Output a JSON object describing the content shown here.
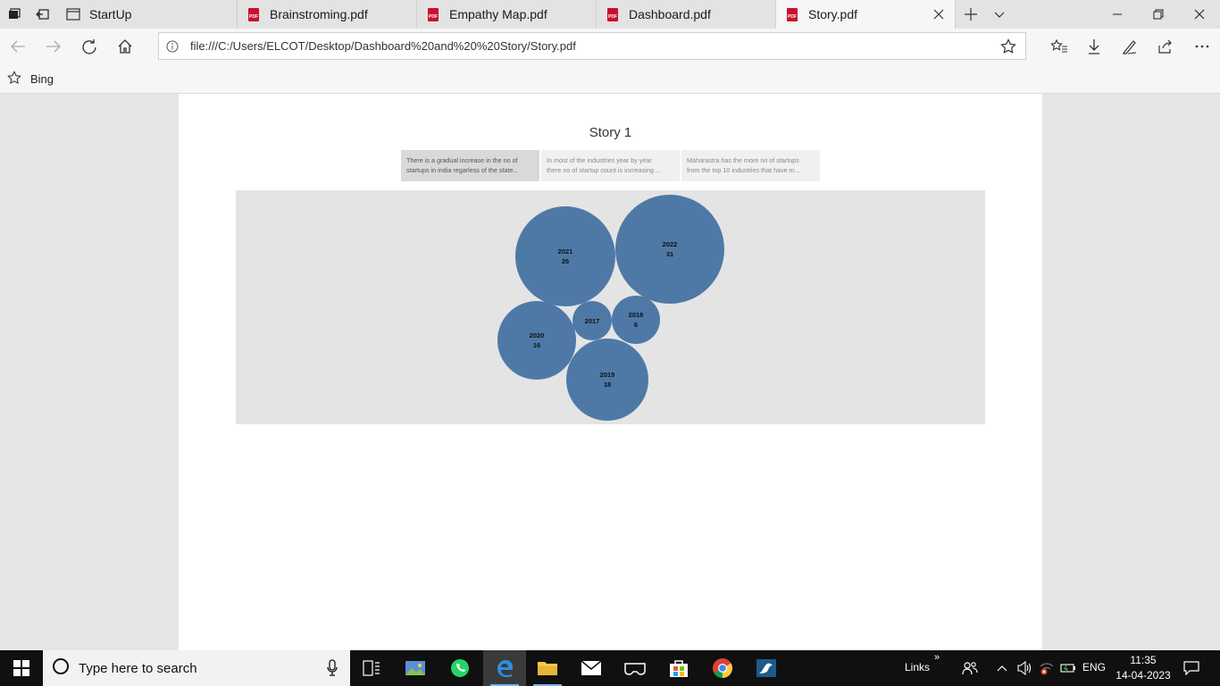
{
  "tabs": [
    {
      "label": "StartUp",
      "icon": "page-icon"
    },
    {
      "label": "Brainstroming.pdf",
      "icon": "pdf-icon"
    },
    {
      "label": "Empathy Map.pdf",
      "icon": "pdf-icon"
    },
    {
      "label": "Dashboard.pdf",
      "icon": "pdf-icon"
    },
    {
      "label": "Story.pdf",
      "icon": "pdf-icon",
      "active": true
    }
  ],
  "pdf_icon_text": "PDF",
  "address": {
    "url": "file:///C:/Users/ELCOT/Desktop/Dashboard%20and%20%20Story/Story.pdf"
  },
  "favorites": [
    {
      "label": "Bing"
    }
  ],
  "story": {
    "title": "Story 1",
    "points": [
      {
        "line1": "There is a gradual increase in the no of",
        "line2": "startups in india regarless of the state..."
      },
      {
        "line1": "In most of the industries year by year",
        "line2": "there no of startup count is increasing ..."
      },
      {
        "line1": "Maharastra has the more no of startups",
        "line2": "from the top 10 industries that have m..."
      }
    ]
  },
  "chart_data": {
    "type": "packed-bubble",
    "color": "#4e79a7",
    "categories": [
      "2022",
      "2021",
      "2019",
      "2020",
      "2018",
      "2017"
    ],
    "values": [
      31,
      26,
      18,
      16,
      6,
      null
    ],
    "labels": [
      {
        "year": "2022",
        "value": "31"
      },
      {
        "year": "2021",
        "value": "26"
      },
      {
        "year": "2019",
        "value": "18"
      },
      {
        "year": "2020",
        "value": "16"
      },
      {
        "year": "2018",
        "value": "6"
      },
      {
        "year": "2017",
        "value": ""
      }
    ]
  },
  "taskbar": {
    "search_placeholder": "Type here to search",
    "links_label": "Links",
    "language": "ENG",
    "time": "11:35",
    "date": "14-04-2023"
  }
}
